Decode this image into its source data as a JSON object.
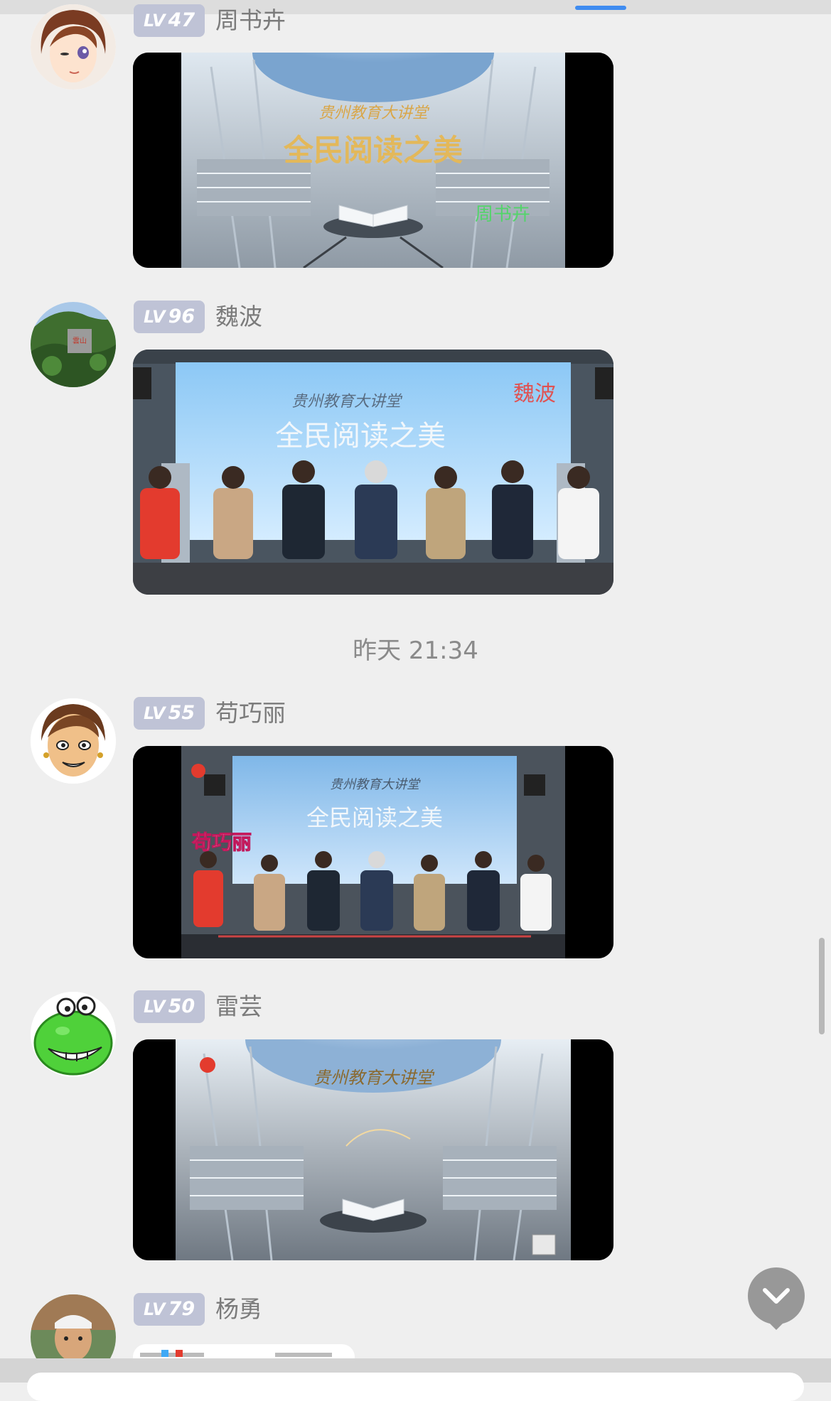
{
  "messages": [
    {
      "level": "47",
      "level_prefix": "LV",
      "sender": "周书卉",
      "video": {
        "title_small": "贵州教育大讲堂",
        "title_big": "全民阅读之美",
        "name_caption": "周书卉",
        "caption_color": "#53d46a",
        "scene": "library-book"
      }
    },
    {
      "level": "96",
      "level_prefix": "LV",
      "sender": "魏波",
      "video": {
        "title_small": "贵州教育大讲堂",
        "title_big": "全民阅读之美",
        "name_caption": "魏波",
        "caption_color": "#e05252",
        "scene": "panel-discussion"
      }
    },
    {
      "level": "55",
      "level_prefix": "LV",
      "sender": "苟巧丽",
      "video": {
        "title_small": "贵州教育大讲堂",
        "title_big": "全民阅读之美",
        "name_caption": "苟巧丽",
        "caption_color": "#ffffff",
        "scene": "panel-discussion-wide"
      }
    },
    {
      "level": "50",
      "level_prefix": "LV",
      "sender": "雷芸",
      "video": {
        "title_small": "贵州教育大讲堂",
        "title_big": "",
        "name_caption": "",
        "caption_color": "#ffffff",
        "scene": "library-book"
      }
    },
    {
      "level": "79",
      "level_prefix": "LV",
      "sender": "杨勇"
    }
  ],
  "time_separator": "昨天 21:34",
  "colors": {
    "background": "#efefef",
    "badge": "#bfc3d6",
    "tab_indicator": "#3f8cf0",
    "name_text": "#7b7b7b"
  },
  "icons": {
    "scroll_down": "chevron-down-icon"
  }
}
